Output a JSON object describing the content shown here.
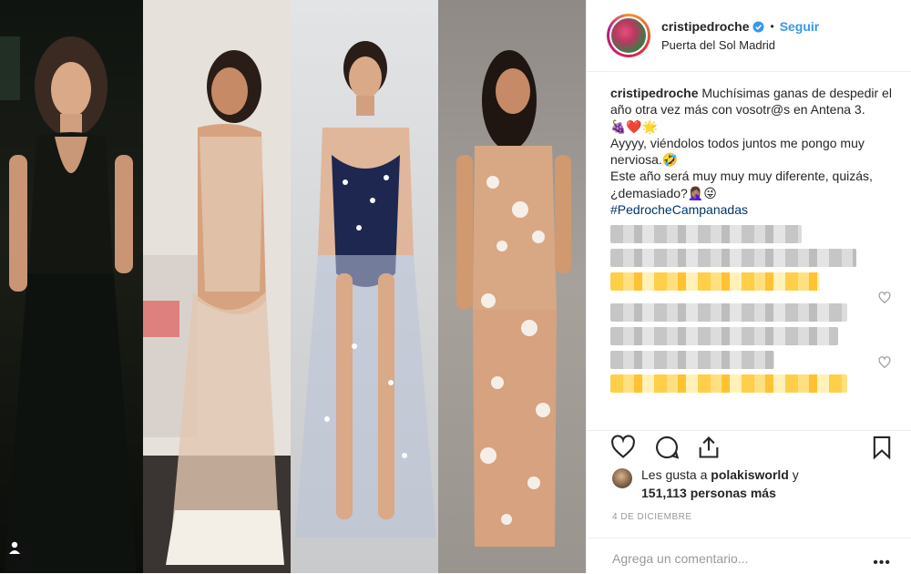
{
  "post": {
    "username": "cristipedroche",
    "follow_label": "Seguir",
    "location": "Puerta del Sol Madrid",
    "caption": {
      "username": "cristipedroche",
      "line1": "Muchísimas ganas de despedir el año otra vez más con vosotr@s en Antena 3.",
      "line2": "🍇❤️🌟",
      "line3": "Ayyyy, viéndolos todos juntos me pongo muy nerviosa.🤣",
      "line4": "Este año será muy muy muy diferente, quizás, ¿demasiado?🤦🏽‍♀️😜",
      "hashtag": "#PedrocheCampanadas"
    },
    "likes": {
      "prefix": "Les gusta a",
      "user": "polakisworld",
      "connector": "y",
      "count": "151,113 personas más"
    },
    "date": "4 DE DICIEMBRE",
    "comment_placeholder": "Agrega un comentario...",
    "more_label": "•••"
  },
  "icons": {
    "verified": "verified-badge-icon",
    "like": "heart-icon",
    "comment": "comment-icon",
    "share": "share-icon",
    "save": "bookmark-icon",
    "profile_badge": "person-icon"
  },
  "colors": {
    "accent_blue": "#3897f0",
    "hashtag": "#003569",
    "muted": "#999999",
    "border": "#efefef"
  }
}
